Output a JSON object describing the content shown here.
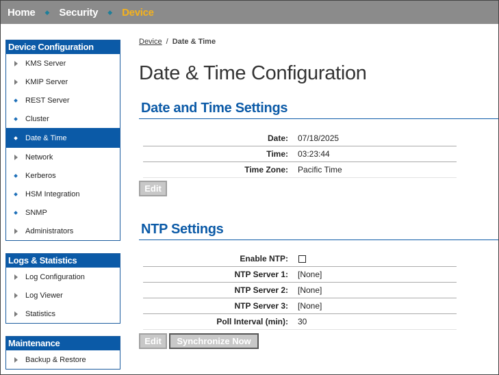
{
  "nav": {
    "home": "Home",
    "security": "Security",
    "device": "Device"
  },
  "sidebar": {
    "device_configuration": {
      "title": "Device Configuration",
      "items": [
        {
          "label": "KMS Server",
          "marker": "triangle"
        },
        {
          "label": "KMIP Server",
          "marker": "triangle"
        },
        {
          "label": "REST Server",
          "marker": "diamond"
        },
        {
          "label": "Cluster",
          "marker": "diamond"
        },
        {
          "label": "Date & Time",
          "marker": "diamond",
          "selected": true
        },
        {
          "label": "Network",
          "marker": "triangle"
        },
        {
          "label": "Kerberos",
          "marker": "diamond"
        },
        {
          "label": "HSM Integration",
          "marker": "diamond"
        },
        {
          "label": "SNMP",
          "marker": "diamond"
        },
        {
          "label": "Administrators",
          "marker": "triangle"
        }
      ]
    },
    "logs_statistics": {
      "title": "Logs & Statistics",
      "items": [
        {
          "label": "Log Configuration",
          "marker": "triangle"
        },
        {
          "label": "Log Viewer",
          "marker": "triangle"
        },
        {
          "label": "Statistics",
          "marker": "triangle"
        }
      ]
    },
    "maintenance": {
      "title": "Maintenance",
      "items": [
        {
          "label": "Backup & Restore",
          "marker": "triangle"
        }
      ]
    }
  },
  "breadcrumb": {
    "parent": "Device",
    "separator": "/",
    "current": "Date & Time"
  },
  "page_title": "Date & Time Configuration",
  "date_time_settings": {
    "title": "Date and Time Settings",
    "rows": [
      {
        "label": "Date:",
        "value": "07/18/2025"
      },
      {
        "label": "Time:",
        "value": "03:23:44"
      },
      {
        "label": "Time Zone:",
        "value": "Pacific Time"
      }
    ],
    "edit_label": "Edit"
  },
  "ntp_settings": {
    "title": "NTP Settings",
    "enable_label": "Enable NTP:",
    "enable_checked": false,
    "rows": [
      {
        "label": "NTP Server 1:",
        "value": "[None]"
      },
      {
        "label": "NTP Server 2:",
        "value": "[None]"
      },
      {
        "label": "NTP Server 3:",
        "value": "[None]"
      },
      {
        "label": "Poll Interval (min):",
        "value": "30"
      }
    ],
    "edit_label": "Edit",
    "sync_label": "Synchronize Now"
  },
  "colors": {
    "topbar": "#8b8b8b",
    "accent": "#0b5aa7",
    "active_nav": "#f5b21c",
    "button_disabled": "#c8c8c8"
  }
}
